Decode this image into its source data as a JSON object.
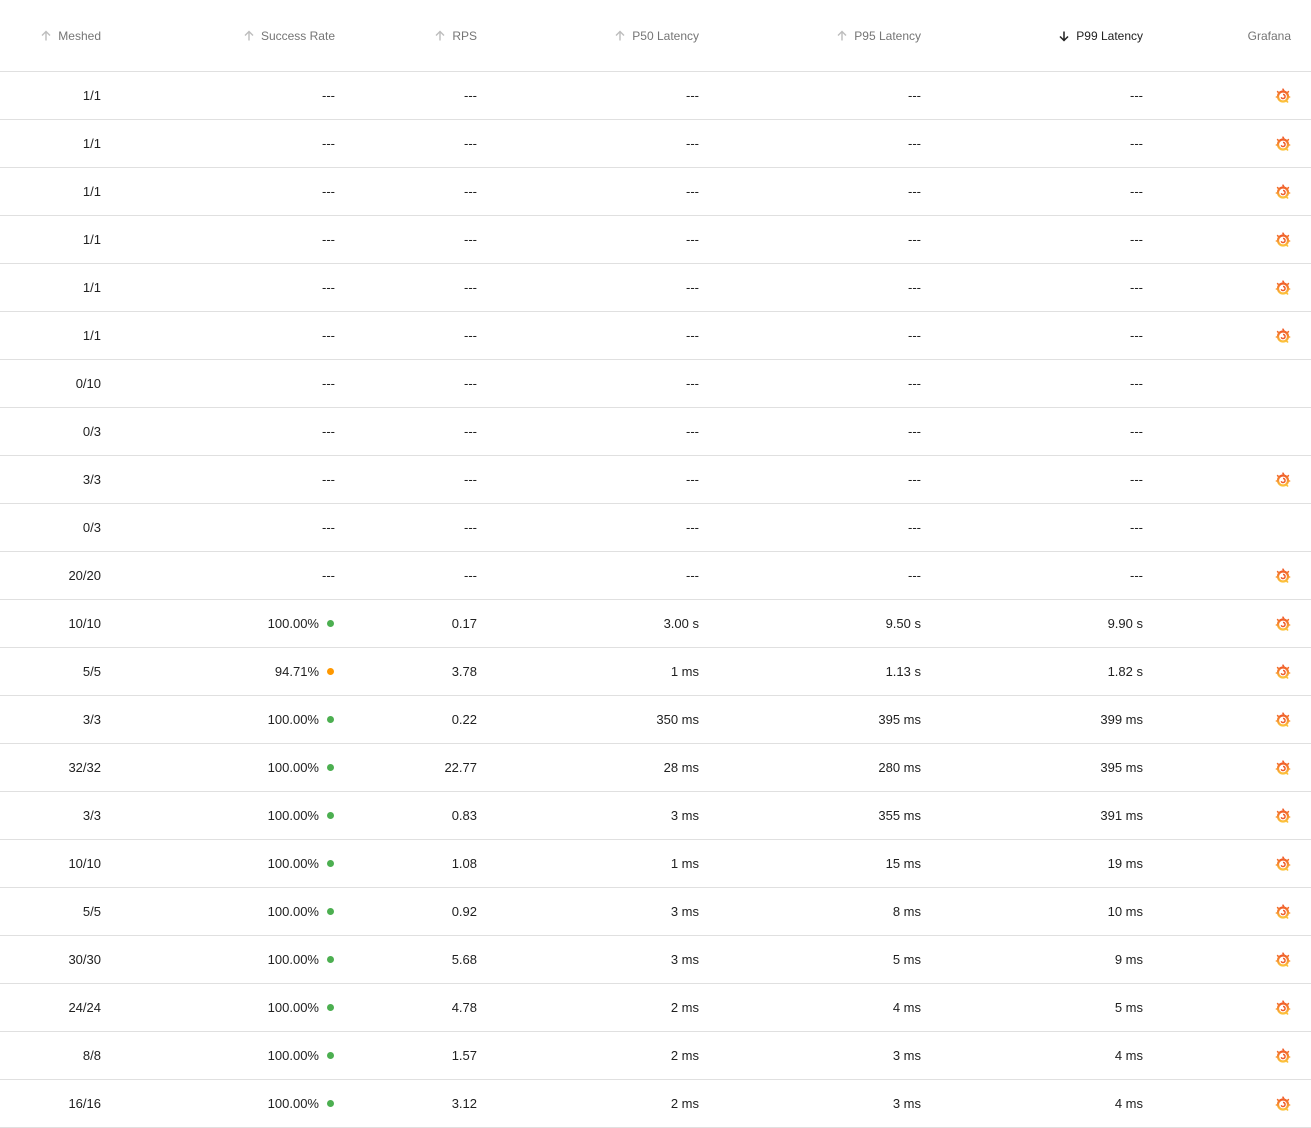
{
  "headers": {
    "meshed": "Meshed",
    "success_rate": "Success Rate",
    "rps": "RPS",
    "p50": "P50 Latency",
    "p95": "P95 Latency",
    "p99": "P99 Latency",
    "grafana": "Grafana"
  },
  "colors": {
    "good": "#4caf50",
    "warning": "#ff9800",
    "grafana": "#f05a28"
  },
  "rows": [
    {
      "meshed": "1/1",
      "success_rate": "---",
      "status": "",
      "rps": "---",
      "p50": "---",
      "p95": "---",
      "p99": "---",
      "grafana": true
    },
    {
      "meshed": "1/1",
      "success_rate": "---",
      "status": "",
      "rps": "---",
      "p50": "---",
      "p95": "---",
      "p99": "---",
      "grafana": true
    },
    {
      "meshed": "1/1",
      "success_rate": "---",
      "status": "",
      "rps": "---",
      "p50": "---",
      "p95": "---",
      "p99": "---",
      "grafana": true
    },
    {
      "meshed": "1/1",
      "success_rate": "---",
      "status": "",
      "rps": "---",
      "p50": "---",
      "p95": "---",
      "p99": "---",
      "grafana": true
    },
    {
      "meshed": "1/1",
      "success_rate": "---",
      "status": "",
      "rps": "---",
      "p50": "---",
      "p95": "---",
      "p99": "---",
      "grafana": true
    },
    {
      "meshed": "1/1",
      "success_rate": "---",
      "status": "",
      "rps": "---",
      "p50": "---",
      "p95": "---",
      "p99": "---",
      "grafana": true
    },
    {
      "meshed": "0/10",
      "success_rate": "---",
      "status": "",
      "rps": "---",
      "p50": "---",
      "p95": "---",
      "p99": "---",
      "grafana": false
    },
    {
      "meshed": "0/3",
      "success_rate": "---",
      "status": "",
      "rps": "---",
      "p50": "---",
      "p95": "---",
      "p99": "---",
      "grafana": false
    },
    {
      "meshed": "3/3",
      "success_rate": "---",
      "status": "",
      "rps": "---",
      "p50": "---",
      "p95": "---",
      "p99": "---",
      "grafana": true
    },
    {
      "meshed": "0/3",
      "success_rate": "---",
      "status": "",
      "rps": "---",
      "p50": "---",
      "p95": "---",
      "p99": "---",
      "grafana": false
    },
    {
      "meshed": "20/20",
      "success_rate": "---",
      "status": "",
      "rps": "---",
      "p50": "---",
      "p95": "---",
      "p99": "---",
      "grafana": true
    },
    {
      "meshed": "10/10",
      "success_rate": "100.00%",
      "status": "good",
      "rps": "0.17",
      "p50": "3.00 s",
      "p95": "9.50 s",
      "p99": "9.90 s",
      "grafana": true
    },
    {
      "meshed": "5/5",
      "success_rate": "94.71%",
      "status": "warning",
      "rps": "3.78",
      "p50": "1 ms",
      "p95": "1.13 s",
      "p99": "1.82 s",
      "grafana": true
    },
    {
      "meshed": "3/3",
      "success_rate": "100.00%",
      "status": "good",
      "rps": "0.22",
      "p50": "350 ms",
      "p95": "395 ms",
      "p99": "399 ms",
      "grafana": true
    },
    {
      "meshed": "32/32",
      "success_rate": "100.00%",
      "status": "good",
      "rps": "22.77",
      "p50": "28 ms",
      "p95": "280 ms",
      "p99": "395 ms",
      "grafana": true
    },
    {
      "meshed": "3/3",
      "success_rate": "100.00%",
      "status": "good",
      "rps": "0.83",
      "p50": "3 ms",
      "p95": "355 ms",
      "p99": "391 ms",
      "grafana": true
    },
    {
      "meshed": "10/10",
      "success_rate": "100.00%",
      "status": "good",
      "rps": "1.08",
      "p50": "1 ms",
      "p95": "15 ms",
      "p99": "19 ms",
      "grafana": true
    },
    {
      "meshed": "5/5",
      "success_rate": "100.00%",
      "status": "good",
      "rps": "0.92",
      "p50": "3 ms",
      "p95": "8 ms",
      "p99": "10 ms",
      "grafana": true
    },
    {
      "meshed": "30/30",
      "success_rate": "100.00%",
      "status": "good",
      "rps": "5.68",
      "p50": "3 ms",
      "p95": "5 ms",
      "p99": "9 ms",
      "grafana": true
    },
    {
      "meshed": "24/24",
      "success_rate": "100.00%",
      "status": "good",
      "rps": "4.78",
      "p50": "2 ms",
      "p95": "4 ms",
      "p99": "5 ms",
      "grafana": true
    },
    {
      "meshed": "8/8",
      "success_rate": "100.00%",
      "status": "good",
      "rps": "1.57",
      "p50": "2 ms",
      "p95": "3 ms",
      "p99": "4 ms",
      "grafana": true
    },
    {
      "meshed": "16/16",
      "success_rate": "100.00%",
      "status": "good",
      "rps": "3.12",
      "p50": "2 ms",
      "p95": "3 ms",
      "p99": "4 ms",
      "grafana": true
    }
  ]
}
